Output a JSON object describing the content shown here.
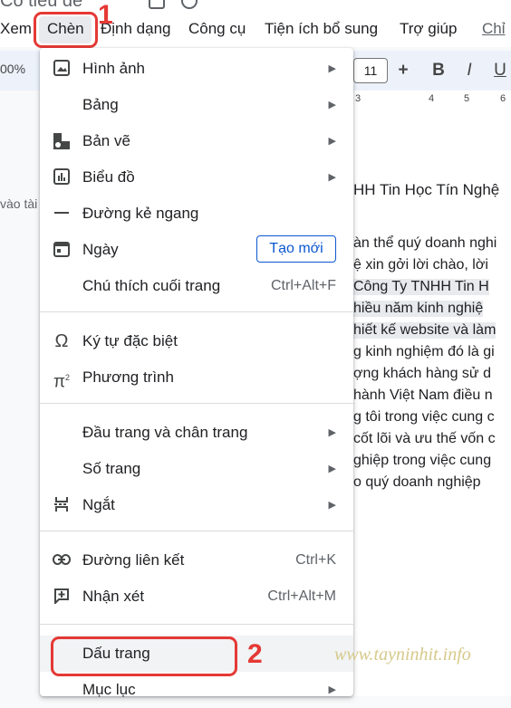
{
  "doc_title": "Có tiêu đề",
  "menubar": {
    "items": [
      "Xem",
      "Chèn",
      "Định dạng",
      "Công cụ",
      "Tiện ích bổ sung",
      "Trợ giúp",
      "Chỉ"
    ]
  },
  "annotations": {
    "step1": "1",
    "step2": "2"
  },
  "toolbar": {
    "zoom": "00%",
    "font_size": "11",
    "plus": "+",
    "bold": "B",
    "italic": "I",
    "underline": "U"
  },
  "ruler": {
    "marks": [
      "3",
      "4",
      "5",
      "6"
    ]
  },
  "left_pane": {
    "text": "vào tài"
  },
  "document": {
    "heading": "HH Tin Học Tín Nghệ",
    "lines": [
      "àn thể quý doanh nghi",
      "ệ xin gởi lời chào, lời",
      " Công Ty TNHH Tin H",
      "hiều năm kinh nghiệ",
      "hiết kế website và làm",
      "g kinh nghiệm đó là gi",
      "ợng khách hàng sử d",
      "hành Việt Nam điều n",
      "g tôi trong việc cung c",
      "cốt lõi và ưu thế vốn c",
      "ghiệp trong việc cung",
      "o quý doanh nghiệp"
    ]
  },
  "menu": {
    "items": [
      {
        "label": "Hình ảnh",
        "icon": "image-icon"
      },
      {
        "label": "Bảng",
        "icon": ""
      },
      {
        "label": "Bản vẽ",
        "icon": "drawing-icon"
      },
      {
        "label": "Biểu đồ",
        "icon": "chart-icon"
      },
      {
        "label": "Đường kẻ ngang",
        "icon": "horizontal-line-icon"
      },
      {
        "label": "Ngày",
        "icon": "calendar-icon",
        "button": "Tạo mới"
      },
      {
        "label": "Chú thích cuối trang",
        "shortcut": "Ctrl+Alt+F"
      },
      {
        "label": "Ký tự đặc biệt",
        "icon": "omega-icon"
      },
      {
        "label": "Phương trình",
        "icon": "pi-icon"
      },
      {
        "label": "Đầu trang và chân trang"
      },
      {
        "label": "Số trang"
      },
      {
        "label": "Ngắt",
        "icon": "page-break-icon"
      },
      {
        "label": "Đường liên kết",
        "icon": "link-icon",
        "shortcut": "Ctrl+K"
      },
      {
        "label": "Nhận xét",
        "icon": "add-comment-icon",
        "shortcut": "Ctrl+Alt+M"
      },
      {
        "label": "Dấu trang"
      },
      {
        "label": "Mục lục"
      }
    ]
  },
  "watermark": "www.tayninhit.info",
  "colors": {
    "annotation_red": "#e53935",
    "menu_bg": "#ffffff",
    "accent_blue": "#0b57d0"
  }
}
